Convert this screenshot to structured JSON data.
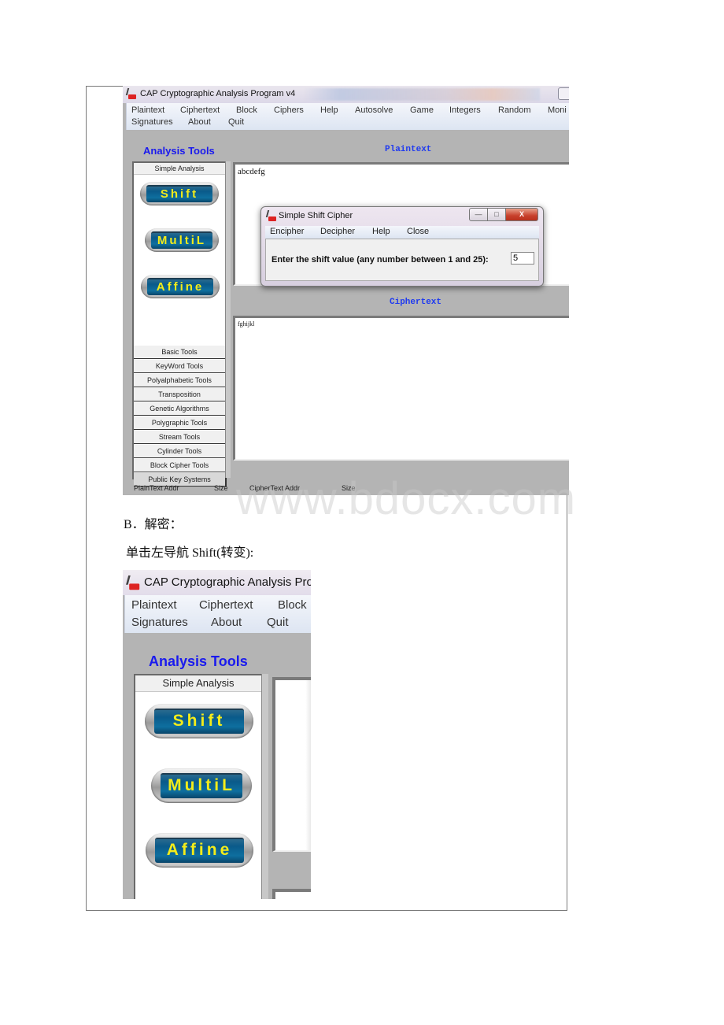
{
  "screenshot1": {
    "window_title": "CAP  Cryptographic Analysis Program v4",
    "menu_row1": [
      "Plaintext",
      "Ciphertext",
      "Block",
      "Ciphers",
      "Help",
      "Autosolve",
      "Game",
      "Integers",
      "Random",
      "Moni"
    ],
    "menu_row2": [
      "Signatures",
      "About",
      "Quit"
    ],
    "left_panel_title": "Analysis Tools",
    "active_tab": "Simple Analysis",
    "tool_buttons": [
      "Shift",
      "MultiL",
      "Affine"
    ],
    "tool_categories": [
      "Basic Tools",
      "KeyWord Tools",
      "Polyalphabetic Tools",
      "Transposition",
      "Genetic Algorithms",
      "Polygraphic Tools",
      "Stream Tools",
      "Cylinder Tools",
      "Block Cipher Tools",
      "Public Key Systems"
    ],
    "plaintext_label": "Plaintext",
    "plaintext_value": "abcdefg",
    "ciphertext_label": "Ciphertext",
    "ciphertext_value": "fghijkl",
    "status": {
      "plaintext_addr": "PlainText Addr",
      "size1": "Size",
      "ciphertext_addr": "CipherText Addr",
      "size2": "Size"
    },
    "dialog": {
      "title": "Simple Shift Cipher",
      "menu": [
        "Encipher",
        "Decipher",
        "Help",
        "Close"
      ],
      "prompt": "Enter the shift value (any number between 1 and 25):",
      "shift_value": "5",
      "close_glyph": "X"
    }
  },
  "document": {
    "heading_b": "B．解密：",
    "instruction": "单击左导航 Shift(转变):",
    "watermark": "www.bdocx.com"
  },
  "screenshot2": {
    "window_title": "CAP  Cryptographic Analysis Pro",
    "menu_row1": [
      "Plaintext",
      "Ciphertext",
      "Block"
    ],
    "menu_row2": [
      "Signatures",
      "About",
      "Quit"
    ],
    "left_panel_title": "Analysis Tools",
    "active_tab": "Simple Analysis",
    "tool_buttons": [
      "Shift",
      "MultiL",
      "Affine"
    ]
  },
  "colors": {
    "panel_title_blue": "#1a1aee",
    "section_title_blue": "#1f3af0",
    "button_text_yellow": "#f4ec1a",
    "button_core_blue": "#0a5a8a",
    "app_background_gray": "#b4b4b4"
  }
}
